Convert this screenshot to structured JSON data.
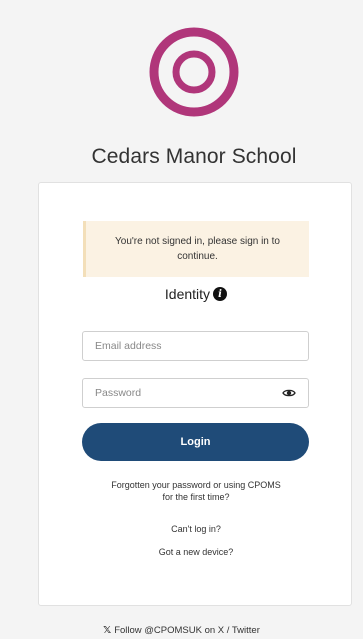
{
  "logo": {
    "icon": "ring-logo-icon",
    "color": "#b0367a"
  },
  "school_name": "Cedars Manor School",
  "notice": {
    "text": "You're not signed in, please sign in to continue."
  },
  "identity": {
    "label": "Identity",
    "icon": "info-icon"
  },
  "form": {
    "email_placeholder": "Email address",
    "password_placeholder": "Password",
    "login_label": "Login"
  },
  "links": {
    "forgot": "Forgotten your password or using CPOMS for the first time?",
    "cant_login": "Can't log in?",
    "new_device": "Got a new device?"
  },
  "footer": {
    "icon": "x-icon",
    "text": "Follow @CPOMSUK on X / Twitter"
  },
  "colors": {
    "accent": "#b0367a",
    "button": "#1f4b78",
    "notice_bg": "#fbf2e3"
  }
}
